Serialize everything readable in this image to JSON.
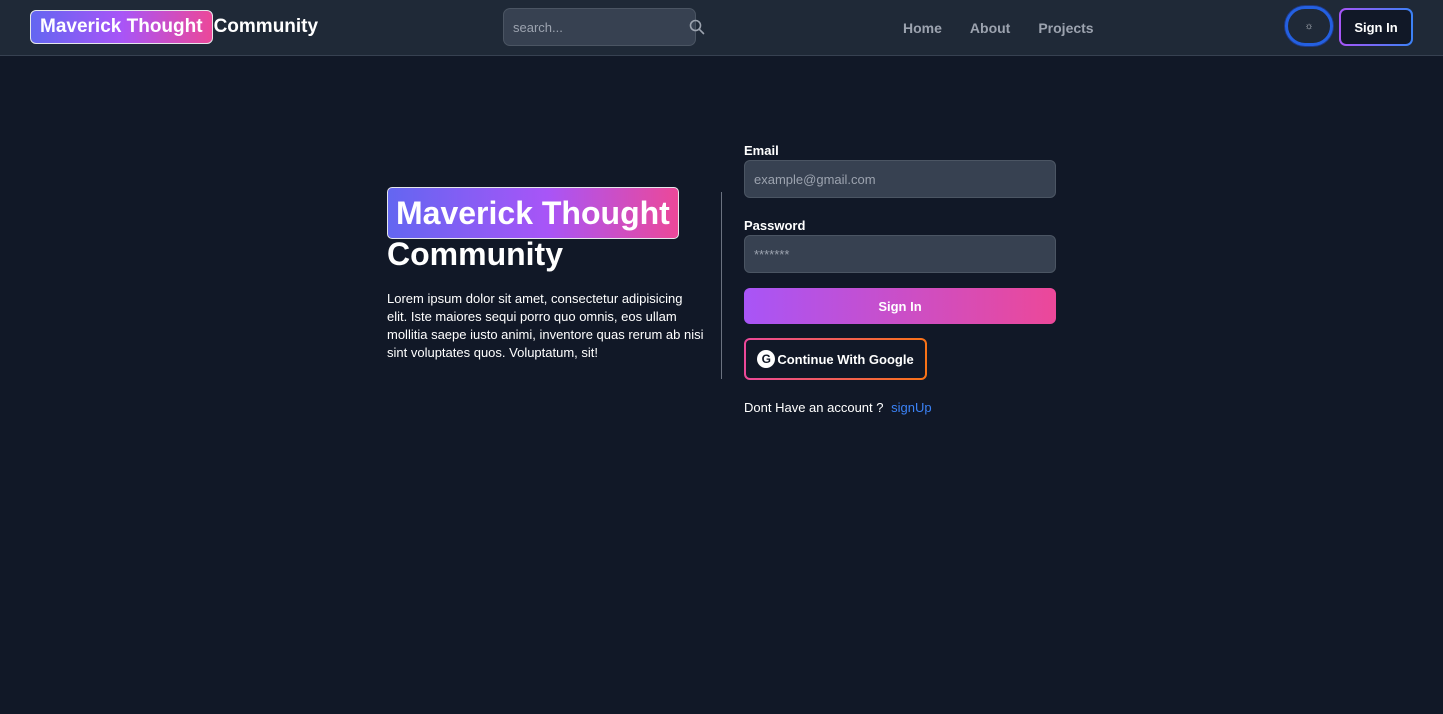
{
  "header": {
    "brand_highlight": "Maverick Thought",
    "brand_rest": "Community",
    "search_placeholder": "search...",
    "nav": [
      {
        "label": "Home"
      },
      {
        "label": "About"
      },
      {
        "label": "Projects"
      }
    ],
    "theme_toggle_icon": "☼",
    "signin_label": "Sign In"
  },
  "hero": {
    "title_highlight": "Maverick Thought",
    "title_rest": "Community",
    "description": "Lorem ipsum dolor sit amet, consectetur adipisicing elit. Iste maiores sequi porro quo omnis, eos ullam mollitia saepe iusto animi, inventore quas rerum ab nisi sint voluptates quos. Voluptatum, sit!"
  },
  "form": {
    "email_label": "Email",
    "email_placeholder": "example@gmail.com",
    "password_label": "Password",
    "password_placeholder": "*******",
    "signin_label": "Sign In",
    "google_icon": "G",
    "google_label": "Continue With Google",
    "signup_prompt": "Dont Have an account ?",
    "signup_link": "signUp"
  },
  "colors": {
    "background": "#111827",
    "navbar": "#1f2937",
    "gradient_start": "#6366f1",
    "gradient_mid": "#a855f7",
    "gradient_end": "#ec4899",
    "link": "#3b82f6"
  },
  "icons": {
    "search": "search-icon",
    "theme": "sun-icon",
    "google": "google-icon"
  }
}
